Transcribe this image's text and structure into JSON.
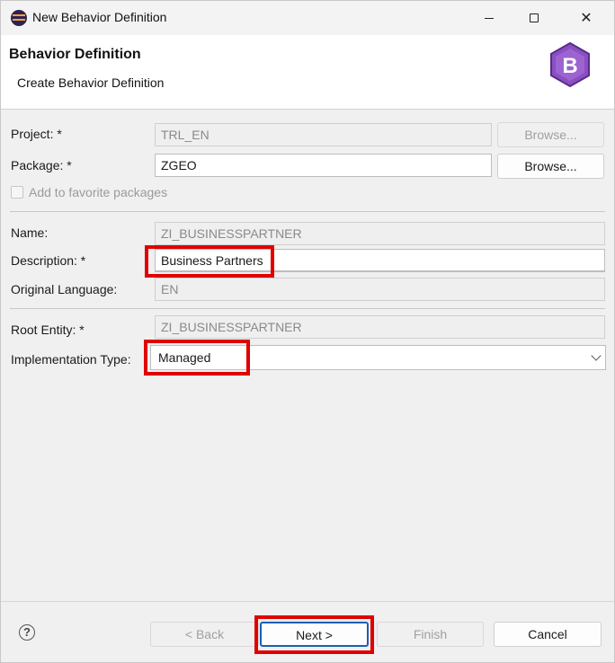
{
  "window": {
    "title": "New Behavior Definition",
    "minimize_icon": "minimize-icon",
    "maximize_icon": "maximize-icon",
    "close_icon": "close-icon",
    "close_glyph": "✕"
  },
  "header": {
    "title": "Behavior Definition",
    "subtitle": "Create Behavior Definition",
    "logo_letter": "B"
  },
  "form": {
    "project": {
      "label": "Project: *",
      "value": "TRL_EN",
      "browse": "Browse..."
    },
    "package": {
      "label": "Package: *",
      "value": "ZGEO",
      "browse": "Browse..."
    },
    "favorite": {
      "label": "Add to favorite packages",
      "checked": false
    },
    "name": {
      "label": "Name:",
      "value": "ZI_BUSINESSPARTNER"
    },
    "description": {
      "label": "Description: *",
      "value": "Business Partners"
    },
    "original_language": {
      "label": "Original Language:",
      "value": "EN"
    },
    "root_entity": {
      "label": "Root Entity: *",
      "value": "ZI_BUSINESSPARTNER"
    },
    "implementation_type": {
      "label": "Implementation Type:",
      "value": "Managed"
    }
  },
  "footer": {
    "help": "?",
    "back": "< Back",
    "next": "Next >",
    "finish": "Finish",
    "cancel": "Cancel"
  },
  "colors": {
    "highlight": "#e00000",
    "focus_underline": "#1a5fb4",
    "logo": "#7b3fb5"
  }
}
